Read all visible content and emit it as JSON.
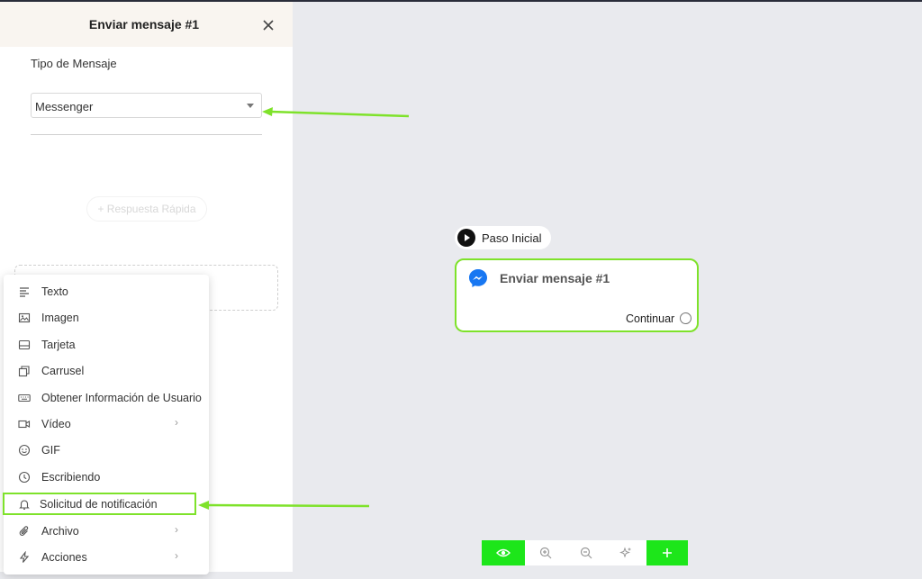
{
  "panel": {
    "title": "Enviar mensaje #1",
    "tipo_label": "Tipo de Mensaje",
    "select_value": "Messenger",
    "quick_reply": "+ Respuesta Rápida"
  },
  "menu": {
    "items": [
      {
        "label": "Texto",
        "icon": "text-icon"
      },
      {
        "label": "Imagen",
        "icon": "image-icon"
      },
      {
        "label": "Tarjeta",
        "icon": "card-icon"
      },
      {
        "label": "Carrusel",
        "icon": "carousel-icon"
      },
      {
        "label": "Obtener Información de Usuario",
        "icon": "keyboard-icon"
      },
      {
        "label": "Vídeo",
        "icon": "video-icon",
        "submenu": true
      },
      {
        "label": "GIF",
        "icon": "gif-icon"
      },
      {
        "label": "Escribiendo",
        "icon": "clock-icon"
      },
      {
        "label": "Solicitud de notificación",
        "icon": "bell-icon",
        "highlighted": true
      },
      {
        "label": "Archivo",
        "icon": "paperclip-icon",
        "submenu": true
      },
      {
        "label": "Acciones",
        "icon": "lightning-icon",
        "submenu": true
      }
    ]
  },
  "canvas": {
    "start_label": "Paso Inicial",
    "card_title": "Enviar mensaje #1",
    "card_continue": "Continuar"
  },
  "toolbar": {
    "buttons": [
      "eye-icon",
      "zoom-in-icon",
      "zoom-out-icon",
      "sparkle-icon",
      "plus-icon"
    ]
  },
  "colors": {
    "accent_green": "#7ee22a",
    "toolbar_green": "#1de61a",
    "messenger_blue": "#1877f2"
  }
}
